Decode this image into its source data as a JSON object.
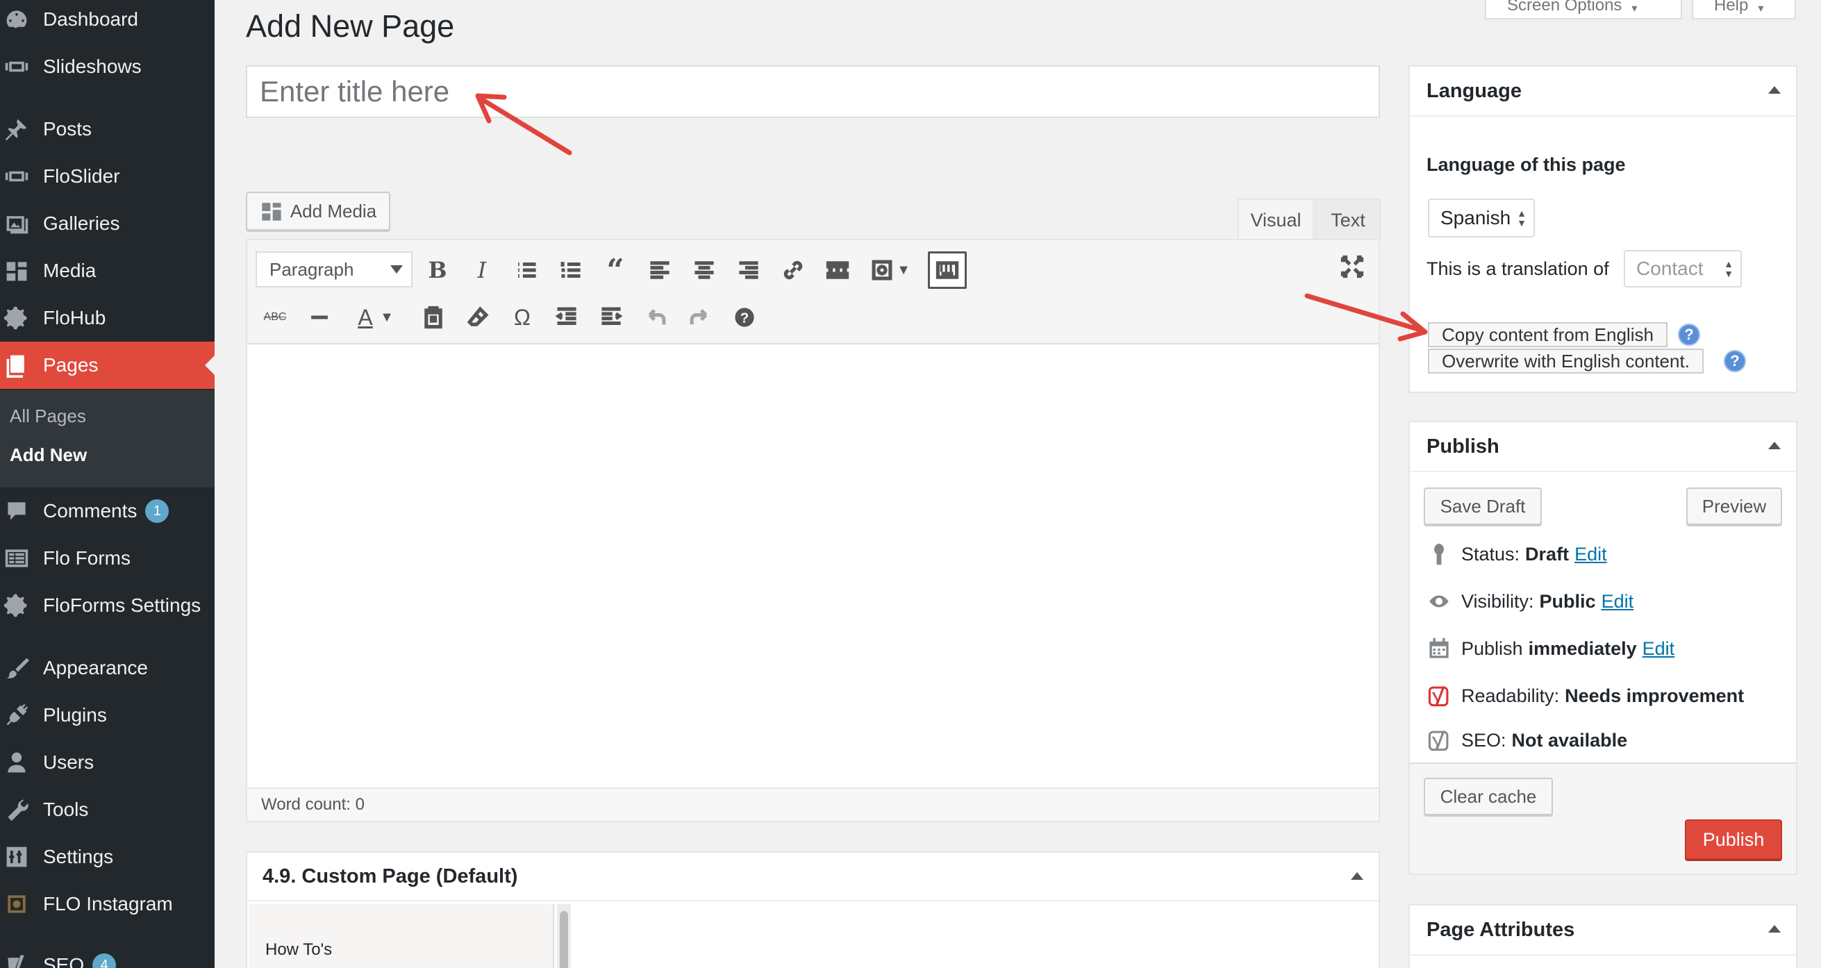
{
  "sidebar": {
    "items": [
      {
        "label": "Dashboard",
        "icon": "dashboard-icon"
      },
      {
        "label": "Slideshows",
        "icon": "slideshow-icon"
      },
      {
        "label": "Posts",
        "icon": "pin-icon"
      },
      {
        "label": "FloSlider",
        "icon": "slider-icon"
      },
      {
        "label": "Galleries",
        "icon": "gallery-icon"
      },
      {
        "label": "Media",
        "icon": "media-icon"
      },
      {
        "label": "FloHub",
        "icon": "gear-icon"
      },
      {
        "label": "Pages",
        "icon": "pages-icon"
      },
      {
        "label": "Comments",
        "icon": "comment-icon",
        "badge": "1"
      },
      {
        "label": "Flo Forms",
        "icon": "forms-icon"
      },
      {
        "label": "FloForms Settings",
        "icon": "gear-icon"
      },
      {
        "label": "Appearance",
        "icon": "brush-icon"
      },
      {
        "label": "Plugins",
        "icon": "plug-icon"
      },
      {
        "label": "Users",
        "icon": "user-icon"
      },
      {
        "label": "Tools",
        "icon": "wrench-icon"
      },
      {
        "label": "Settings",
        "icon": "sliders-icon"
      },
      {
        "label": "FLO Instagram",
        "icon": "instagram-icon"
      },
      {
        "label": "SEO",
        "icon": "yoast-icon",
        "badge": "4"
      }
    ],
    "submenu": {
      "all_pages": "All Pages",
      "add_new": "Add New"
    }
  },
  "header": {
    "title": "Add New Page",
    "screen_options": "Screen Options",
    "help": "Help"
  },
  "editor": {
    "title_placeholder": "Enter title here",
    "add_media": "Add Media",
    "tab_visual": "Visual",
    "tab_text": "Text",
    "format": "Paragraph",
    "word_count": "Word count: 0"
  },
  "custom_page": {
    "title": "4.9. Custom Page (Default)",
    "list_item": "How To's"
  },
  "language": {
    "title": "Language",
    "label": "Language of this page",
    "selected": "Spanish",
    "translation_label": "This is a translation of",
    "translation_value": "Contact",
    "copy_button": "Copy content from English",
    "overwrite_button": "Overwrite with English content.",
    "help_glyph": "?"
  },
  "publish": {
    "title": "Publish",
    "save_draft": "Save Draft",
    "preview": "Preview",
    "status_label": "Status:",
    "status_value": "Draft",
    "visibility_label": "Visibility:",
    "visibility_value": "Public",
    "publish_label": "Publish",
    "publish_value": "immediately",
    "readability_label": "Readability:",
    "readability_value": "Needs improvement",
    "seo_label": "SEO:",
    "seo_value": "Not available",
    "edit": "Edit",
    "clear_cache": "Clear cache",
    "publish_button": "Publish"
  },
  "page_attributes": {
    "title": "Page Attributes"
  },
  "colors": {
    "accent": "#e04a3d",
    "sidebar": "#23282d",
    "link": "#0073aa",
    "arrow": "#e0443d"
  }
}
